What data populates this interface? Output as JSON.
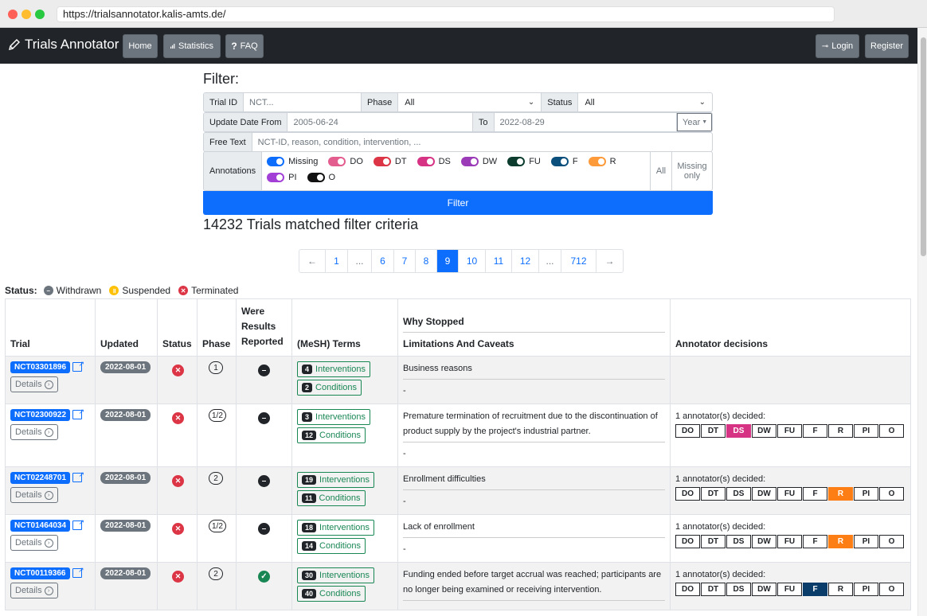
{
  "browser": {
    "url": "https://trialsannotator.kalis-amts.de/"
  },
  "navbar": {
    "brand": "Trials Annotator",
    "home": "Home",
    "statistics": "Statistics",
    "faq": "FAQ",
    "login": "Login",
    "register": "Register"
  },
  "filter": {
    "title": "Filter:",
    "trial_id_label": "Trial ID",
    "trial_id_placeholder": "NCT...",
    "phase_label": "Phase",
    "phase_value": "All",
    "status_label": "Status",
    "status_value": "All",
    "update_from_label": "Update Date From",
    "update_from_value": "2005-06-24",
    "to_label": "To",
    "to_value": "2022-08-29",
    "period_value": "Year",
    "free_text_label": "Free Text",
    "free_text_placeholder": "NCT-ID, reason, condition, intervention, ...",
    "annotations_label": "Annotations",
    "toggles": [
      {
        "label": "Missing",
        "color": "#0d6efd"
      },
      {
        "label": "DO",
        "color": "#e35d8f"
      },
      {
        "label": "DT",
        "color": "#dc3545"
      },
      {
        "label": "DS",
        "color": "#d63384"
      },
      {
        "label": "DW",
        "color": "#9c3bb8"
      },
      {
        "label": "FU",
        "color": "#0b3c2e"
      },
      {
        "label": "F",
        "color": "#0b4f7c"
      },
      {
        "label": "R",
        "color": "#fd9a3a"
      },
      {
        "label": "PI",
        "color": "#a23fd6"
      },
      {
        "label": "O",
        "color": "#111111"
      }
    ],
    "all_label": "All",
    "missing_only_label": "Missing only",
    "submit_label": "Filter"
  },
  "results": {
    "matched_text": "14232 Trials matched filter criteria"
  },
  "pagination": {
    "prev": "←",
    "pages": [
      "1",
      "...",
      "6",
      "7",
      "8",
      "9",
      "10",
      "11",
      "12",
      "...",
      "712"
    ],
    "active": "9",
    "next": "→"
  },
  "status_legend": {
    "label": "Status:",
    "withdrawn": "Withdrawn",
    "suspended": "Suspended",
    "terminated": "Terminated"
  },
  "table": {
    "headers": {
      "trial": "Trial",
      "updated": "Updated",
      "status": "Status",
      "phase": "Phase",
      "results_reported": "Were Results Reported",
      "terms": "(MeSH) Terms",
      "why_stopped": "Why Stopped",
      "limitations": "Limitations And Caveats",
      "annotator": "Annotator decisions"
    },
    "details_label": "Details",
    "interventions_label": "Interventions",
    "conditions_label": "Conditions",
    "decision_labels": [
      "DO",
      "DT",
      "DS",
      "DW",
      "FU",
      "F",
      "R",
      "PI",
      "O"
    ],
    "rows": [
      {
        "nct": "NCT03301896",
        "updated": "2022-08-01",
        "phase": "1",
        "reported": "no",
        "interventions": "4",
        "conditions": "2",
        "why": "Business reasons",
        "caveat": "-",
        "decided": "",
        "selected": ""
      },
      {
        "nct": "NCT02300922",
        "updated": "2022-08-01",
        "phase": "1/2",
        "reported": "no",
        "interventions": "3",
        "conditions": "12",
        "why": "Premature termination of recruitment due to the discontinuation of product supply by the project's industrial partner.",
        "caveat": "-",
        "decided": "1 annotator(s) decided:",
        "selected": "DS"
      },
      {
        "nct": "NCT02248701",
        "updated": "2022-08-01",
        "phase": "2",
        "reported": "no",
        "interventions": "19",
        "conditions": "11",
        "why": "Enrollment difficulties",
        "caveat": "-",
        "decided": "1 annotator(s) decided:",
        "selected": "R"
      },
      {
        "nct": "NCT01464034",
        "updated": "2022-08-01",
        "phase": "1/2",
        "reported": "no",
        "interventions": "18",
        "conditions": "14",
        "why": "Lack of enrollment",
        "caveat": "-",
        "decided": "1 annotator(s) decided:",
        "selected": "R"
      },
      {
        "nct": "NCT00119366",
        "updated": "2022-08-01",
        "phase": "2",
        "reported": "yes",
        "interventions": "30",
        "conditions": "40",
        "why": "Funding ended before target accrual was reached; participants are no longer being examined or receiving intervention.",
        "caveat": "",
        "decided": "1 annotator(s) decided:",
        "selected": "F"
      }
    ]
  }
}
